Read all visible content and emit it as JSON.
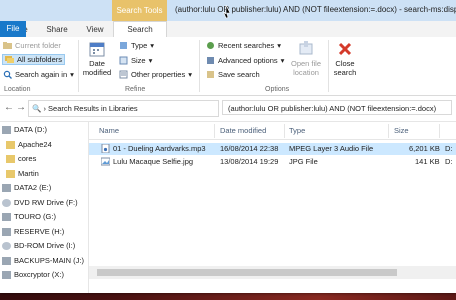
{
  "window": {
    "title": "(author:lulu OR publisher:lulu) AND (NOT fileextension:=.docx) - search-ms:display"
  },
  "ribbon": {
    "contextual_tab": "Search Tools",
    "tabs": [
      "File",
      "Home",
      "Share",
      "View",
      "Search"
    ],
    "groups": {
      "location": {
        "label": "Location",
        "current_folder": "Current folder",
        "all_subfolders": "All subfolders",
        "search_again": "Search again in"
      },
      "refine": {
        "label": "Refine",
        "date_modified": "Date modified",
        "kind": "Type",
        "size": "Size",
        "other_properties": "Other properties"
      },
      "options": {
        "label": "Options",
        "recent_searches": "Recent searches",
        "advanced_options": "Advanced options",
        "save_search": "Save search",
        "open_file_location": "Open file location"
      },
      "close": {
        "label": "Close search"
      }
    }
  },
  "address_bar": {
    "path": "Search Results in Libraries",
    "search_query": "(author:lulu OR publisher:lulu) AND (NOT fileextension:=.docx)"
  },
  "nav_pane": {
    "items": [
      "DATA (D:)",
      "Apache24",
      "cores",
      "Martin",
      "DATA2 (E:)",
      "DVD RW Drive (F:)",
      "TOURO (G:)",
      "RESERVE (H:)",
      "BD-ROM Drive (I:)",
      "BACKUPS-MAIN (J:)",
      "Boxcryptor (X:)"
    ]
  },
  "file_list": {
    "columns": [
      "Name",
      "Date modified",
      "Type",
      "Size",
      "Folder"
    ],
    "rows": [
      {
        "name": "01 - Dueling Aardvarks.mp3",
        "date": "16/08/2014 22:38",
        "type": "MPEG Layer 3 Audio File",
        "size": "6,201 KB",
        "folder": "D:"
      },
      {
        "name": "Lulu Macaque Selfie.jpg",
        "date": "13/08/2014 19:29",
        "type": "JPG File",
        "size": "141 KB",
        "folder": "D:"
      }
    ]
  },
  "colors": {
    "titlebar": "#cde1f5",
    "contextual_tab": "#e8c26a",
    "file_tab": "#1979ca",
    "selection": "#cce8ff"
  }
}
